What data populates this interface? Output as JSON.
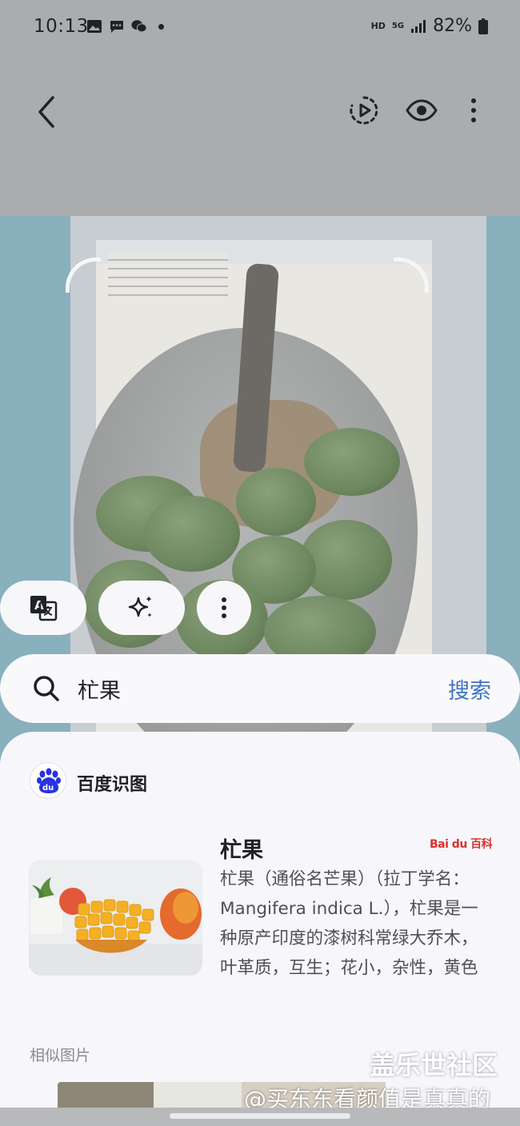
{
  "status_bar": {
    "time": "10:13",
    "network_hd": "HD",
    "network_5g": "5G",
    "battery": "82%"
  },
  "app_bar": {
    "back_icon": "chevron-left-icon",
    "icons": [
      "motion-photo-icon",
      "eye-icon",
      "more-vert-icon"
    ]
  },
  "chips": [
    "translate-icon",
    "sparkle-icon",
    "more-vert-icon"
  ],
  "search": {
    "query": "杧果",
    "button": "搜索"
  },
  "results": {
    "provider": "百度识图",
    "title": "杧果",
    "badge": "Bai du 百科",
    "description": "杧果（通俗名芒果）（拉丁学名：Mangifera indica L.），杧果是一种原产印度的漆树科常绿大乔木，叶革质，互生；花小，杂性，黄色或淡黄色，…",
    "similar_label": "相似图片"
  },
  "watermark": {
    "line1": "盖乐世社区",
    "line2": "@买东东看颜值是真真的"
  },
  "colors": {
    "accent": "#3e73c2",
    "sheet_bg": "#f7f6fb"
  }
}
